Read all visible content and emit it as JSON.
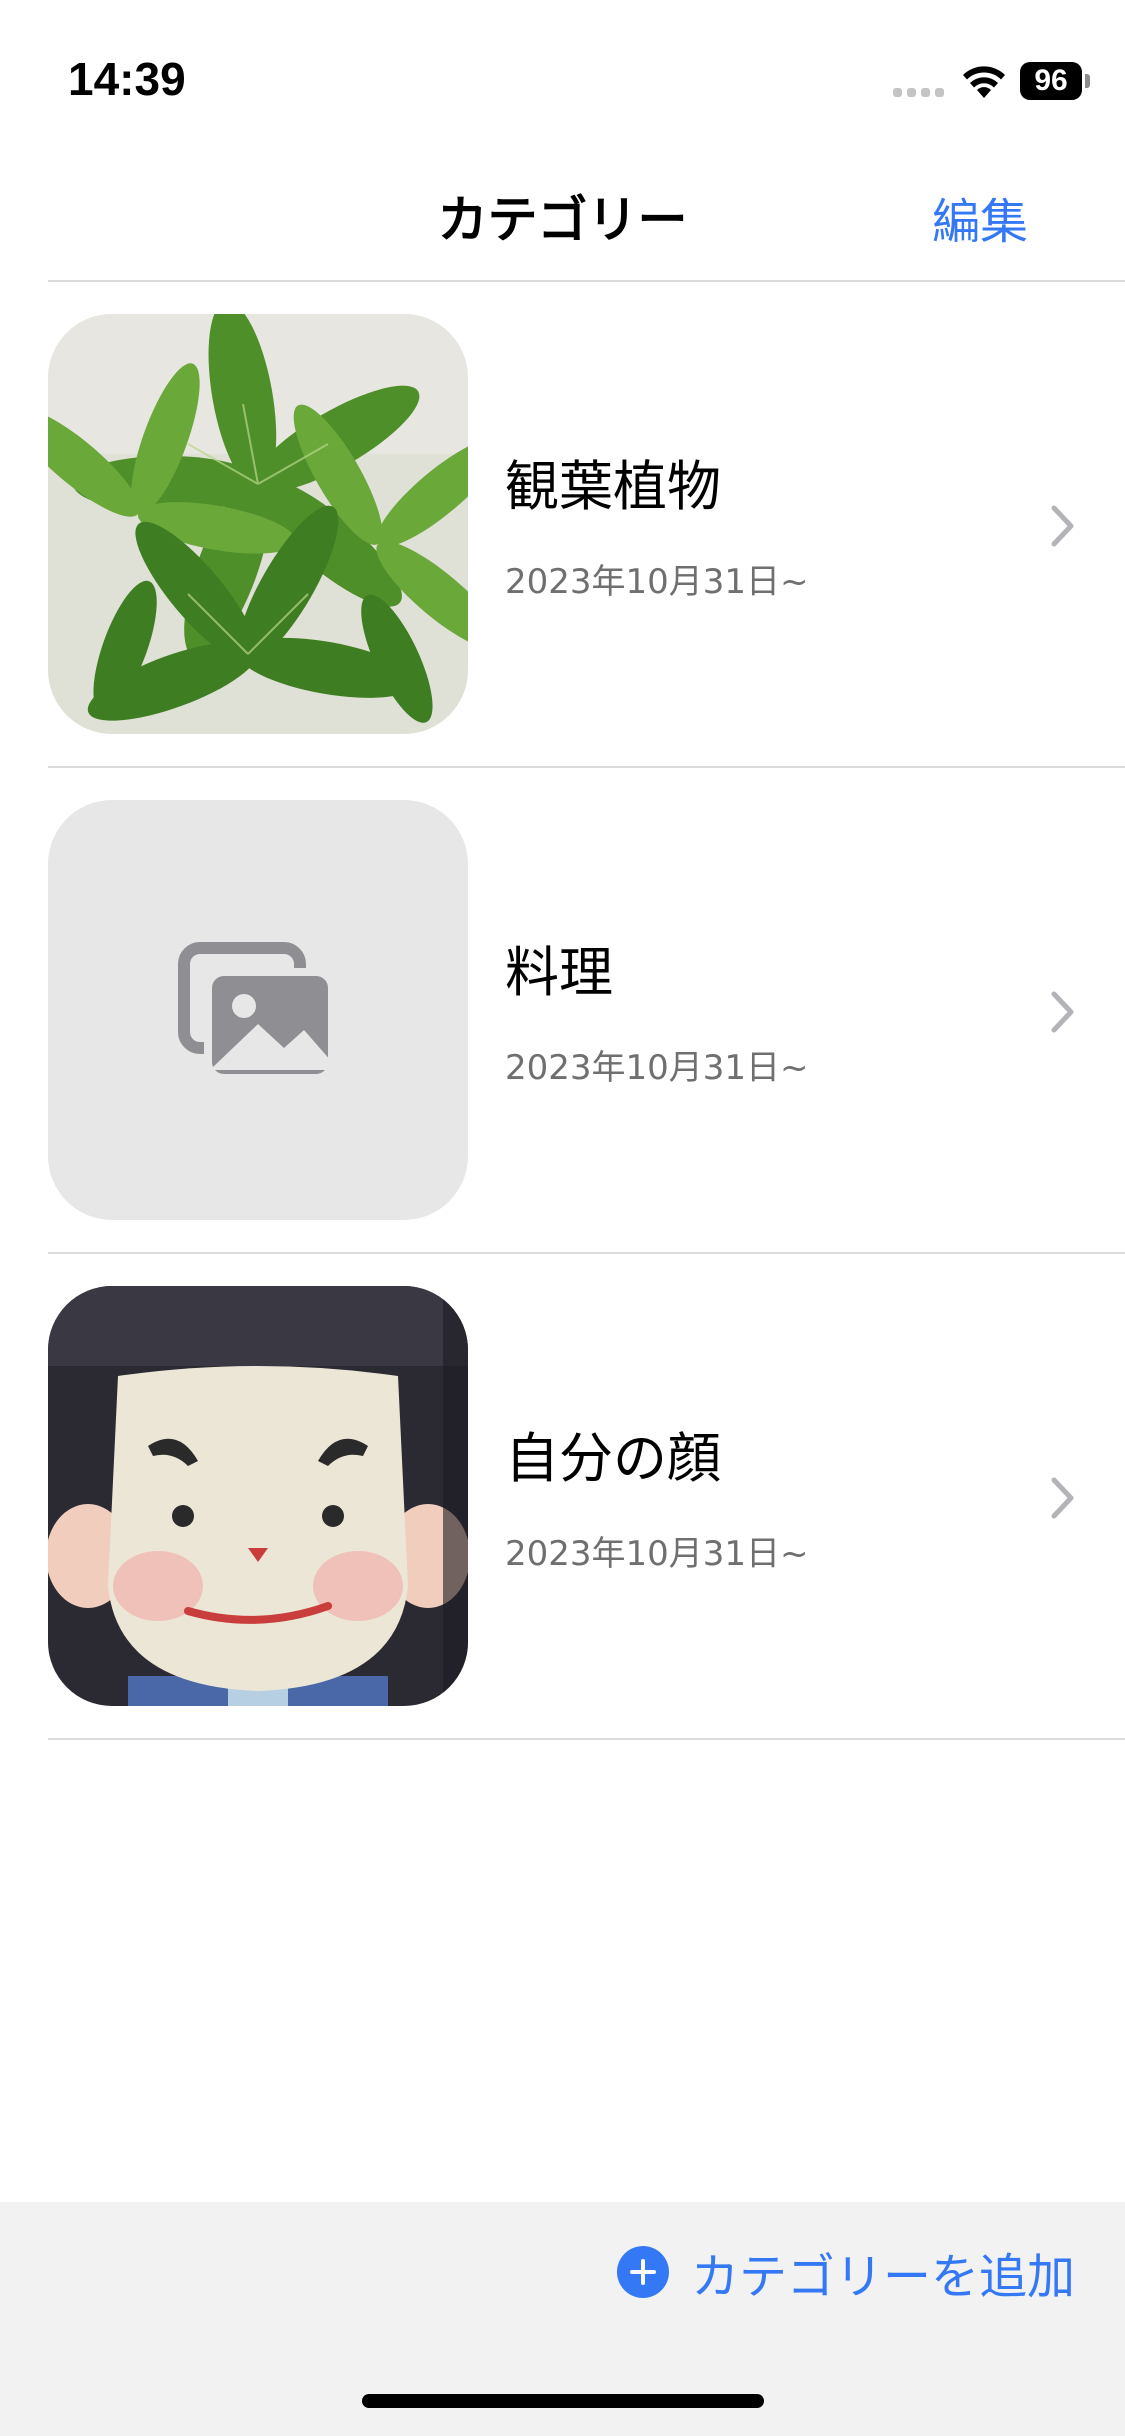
{
  "status_bar": {
    "time": "14:39",
    "battery_percent": "96",
    "icons": [
      "signal-icon",
      "wifi-icon",
      "battery-icon"
    ]
  },
  "nav": {
    "title": "カテゴリー",
    "edit_label": "編集"
  },
  "categories": [
    {
      "title": "観葉植物",
      "date": "2023年10月31日~",
      "thumbnail": "plant-photo"
    },
    {
      "title": "料理",
      "date": "2023年10月31日~",
      "thumbnail": "photo-placeholder-icon"
    },
    {
      "title": "自分の顔",
      "date": "2023年10月31日~",
      "thumbnail": "face-illustration-photo"
    }
  ],
  "toolbar": {
    "add_label": "カテゴリーを追加"
  },
  "colors": {
    "accent": "#3478f6",
    "secondary_text": "#6f6f6f",
    "toolbar_bg": "#f2f2f2",
    "placeholder_bg": "#e7e7e7"
  }
}
